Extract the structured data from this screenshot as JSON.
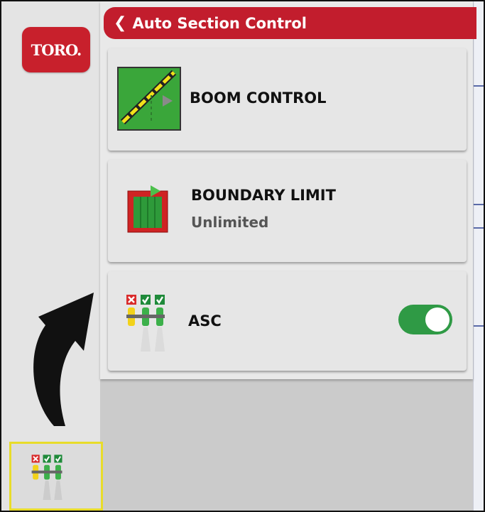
{
  "app": {
    "logo_text": "TORO.",
    "colors": {
      "brand_red": "#c21d2d",
      "toggle_on": "#2f9a45",
      "highlight": "#e8dc2a"
    }
  },
  "panel": {
    "header": {
      "back_icon": "chevron-left-icon",
      "title": "Auto Section Control"
    },
    "items": [
      {
        "icon": "boom-control-icon",
        "title": "BOOM CONTROL"
      },
      {
        "icon": "boundary-limit-icon",
        "title": "BOUNDARY LIMIT",
        "subtitle": "Unlimited"
      },
      {
        "icon": "asc-sections-icon",
        "title": "ASC",
        "toggle_on": true
      }
    ]
  },
  "sidebar": {
    "selected_icon": "asc-sections-icon"
  }
}
